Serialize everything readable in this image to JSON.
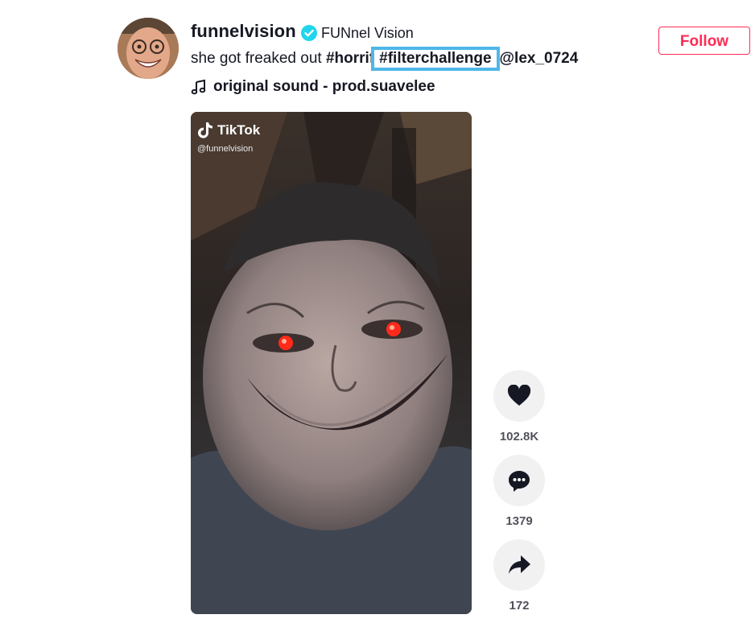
{
  "post": {
    "username": "funnelvision",
    "display_name": "FUNnel Vision",
    "caption_text": "she got freaked out ",
    "hashtag_1": "#horrif",
    "hashtag_2": "#filterchallenge",
    "mention": "@lex_0724",
    "sound": "original sound - prod.suavelee",
    "follow_label": "Follow"
  },
  "video": {
    "watermark_brand": "TikTok",
    "watermark_handle": "@funnelvision"
  },
  "actions": {
    "likes": "102.8K",
    "comments": "1379",
    "shares": "172"
  },
  "colors": {
    "accent": "#fe2c55",
    "verified": "#20d5ec",
    "highlight_box": "#4fb7e8"
  },
  "icons": [
    "verified-badge-icon",
    "music-note-icon",
    "heart-icon",
    "comment-icon",
    "share-icon",
    "tiktok-logo-icon"
  ]
}
